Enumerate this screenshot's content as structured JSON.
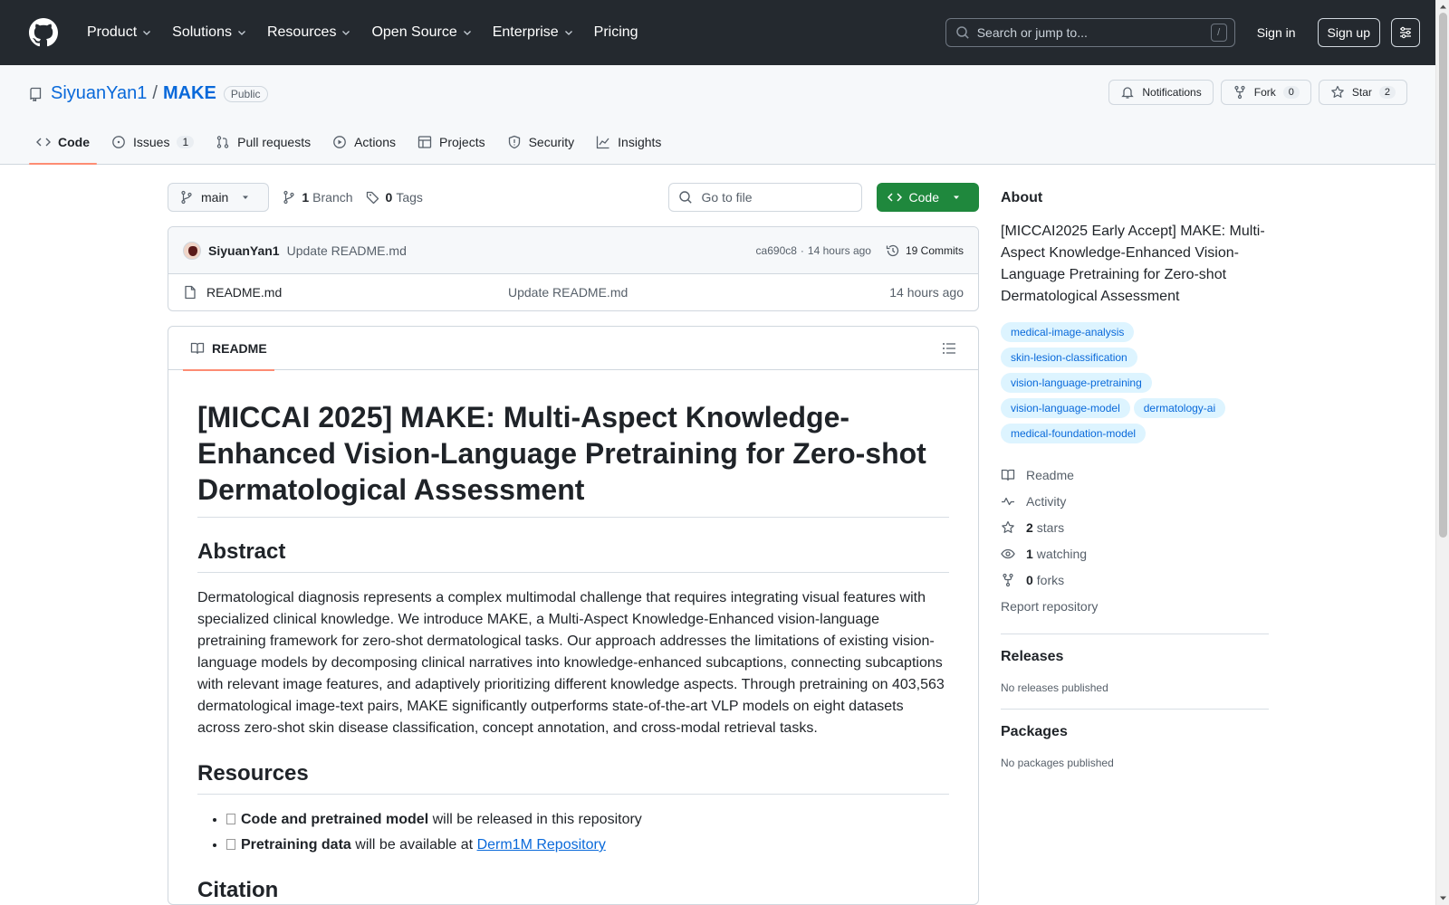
{
  "header": {
    "nav": [
      "Product",
      "Solutions",
      "Resources",
      "Open Source",
      "Enterprise",
      "Pricing"
    ],
    "search_placeholder": "Search or jump to...",
    "search_shortcut": "/",
    "sign_in": "Sign in",
    "sign_up": "Sign up"
  },
  "repo": {
    "owner": "SiyuanYan1",
    "separator": "/",
    "name": "MAKE",
    "visibility": "Public",
    "notifications_label": "Notifications",
    "fork_label": "Fork",
    "fork_count": "0",
    "star_label": "Star",
    "star_count": "2"
  },
  "tabs": {
    "code": "Code",
    "issues": "Issues",
    "issues_count": "1",
    "pulls": "Pull requests",
    "actions": "Actions",
    "projects": "Projects",
    "security": "Security",
    "insights": "Insights"
  },
  "toolbar": {
    "branch": "main",
    "branch_count": "1",
    "branch_label": "Branch",
    "tag_count": "0",
    "tag_label": "Tags",
    "go_to_file": "Go to file",
    "code_button": "Code"
  },
  "commit": {
    "author": "SiyuanYan1",
    "message": "Update README.md",
    "hash": "ca690c8",
    "dot": "·",
    "time": "14 hours ago",
    "commits_label": "19 Commits"
  },
  "files": [
    {
      "name": "README.md",
      "message": "Update README.md",
      "time": "14 hours ago"
    }
  ],
  "readme": {
    "tab": "README",
    "title": "[MICCAI 2025] MAKE: Multi-Aspect Knowledge-Enhanced Vision-Language Pretraining for Zero-shot Dermatological Assessment",
    "abstract_heading": "Abstract",
    "abstract": "Dermatological diagnosis represents a complex multimodal challenge that requires integrating visual features with specialized clinical knowledge. We introduce MAKE, a Multi-Aspect Knowledge-Enhanced vision-language pretraining framework for zero-shot dermatological tasks. Our approach addresses the limitations of existing vision-language models by decomposing clinical narratives into knowledge-enhanced subcaptions, connecting subcaptions with relevant image features, and adaptively prioritizing different knowledge aspects. Through pretraining on 403,563 dermatological image-text pairs, MAKE significantly outperforms state-of-the-art VLP models on eight datasets across zero-shot skin disease classification, concept annotation, and cross-modal retrieval tasks.",
    "resources_heading": "Resources",
    "resource_1_bold": "Code and pretrained model",
    "resource_1_rest": " will be released in this repository",
    "resource_2_bold": "Pretraining data",
    "resource_2_rest": " will be available at ",
    "resource_2_link": "Derm1M Repository",
    "citation_heading": "Citation"
  },
  "about": {
    "heading": "About",
    "description": "[MICCAI2025 Early Accept] MAKE: Multi-Aspect Knowledge-Enhanced Vision-Language Pretraining for Zero-shot Dermatological Assessment",
    "topics": [
      "medical-image-analysis",
      "skin-lesion-classification",
      "vision-language-pretraining",
      "vision-language-model",
      "dermatology-ai",
      "medical-foundation-model"
    ],
    "readme": "Readme",
    "activity": "Activity",
    "stars_count": "2",
    "stars_label": "stars",
    "watching_count": "1",
    "watching_label": "watching",
    "forks_count": "0",
    "forks_label": "forks",
    "report": "Report repository"
  },
  "releases": {
    "heading": "Releases",
    "empty": "No releases published"
  },
  "packages": {
    "heading": "Packages",
    "empty": "No packages published"
  },
  "colors": {
    "header_bg": "#24292f",
    "link": "#0969da",
    "code_button": "#1f883d",
    "tab_underline": "#fd8c73",
    "topic_bg": "#ddf4ff"
  }
}
